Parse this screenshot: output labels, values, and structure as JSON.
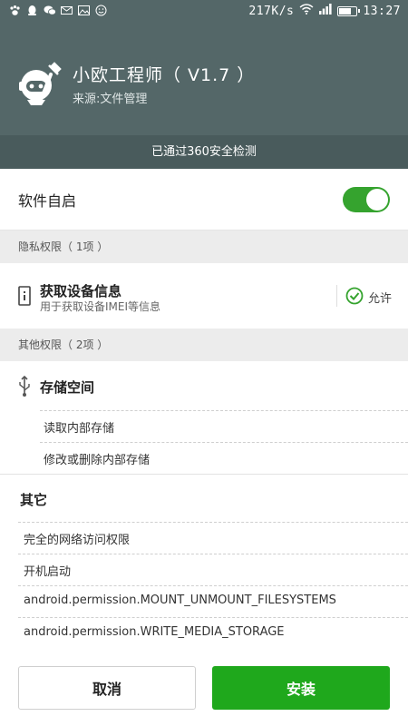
{
  "status_bar": {
    "speed": "217K/s",
    "time": "13:27",
    "battery_level": 0.7,
    "left_icons": [
      "paw-icon",
      "qq-icon",
      "wechat-icon",
      "mail-icon",
      "image-icon",
      "emoji-icon"
    ]
  },
  "app": {
    "name": "小欧工程师（ V1.7 ）",
    "source": "来源:文件管理",
    "security_notice": "已通过360安全检测"
  },
  "autostart": {
    "label": "软件自启",
    "enabled": true
  },
  "privacy_section": {
    "header": "隐私权限（ 1项 ）",
    "item": {
      "title": "获取设备信息",
      "desc": "用于获取设备IMEI等信息",
      "status": "允许"
    }
  },
  "other_section": {
    "header": "其他权限（ 2项 ）",
    "storage": {
      "title": "存储空间",
      "items": [
        "读取内部存储",
        "修改或删除内部存储"
      ]
    }
  },
  "misc": {
    "title": "其它",
    "items": [
      "完全的网络访问权限",
      "开机启动",
      "android.permission.MOUNT_UNMOUNT_FILESYSTEMS",
      "android.permission.WRITE_MEDIA_STORAGE"
    ]
  },
  "footer": {
    "cancel": "取消",
    "install": "安装"
  },
  "colors": {
    "header": "#546768",
    "accent": "#1fa81c",
    "toggle": "#35a32e"
  }
}
